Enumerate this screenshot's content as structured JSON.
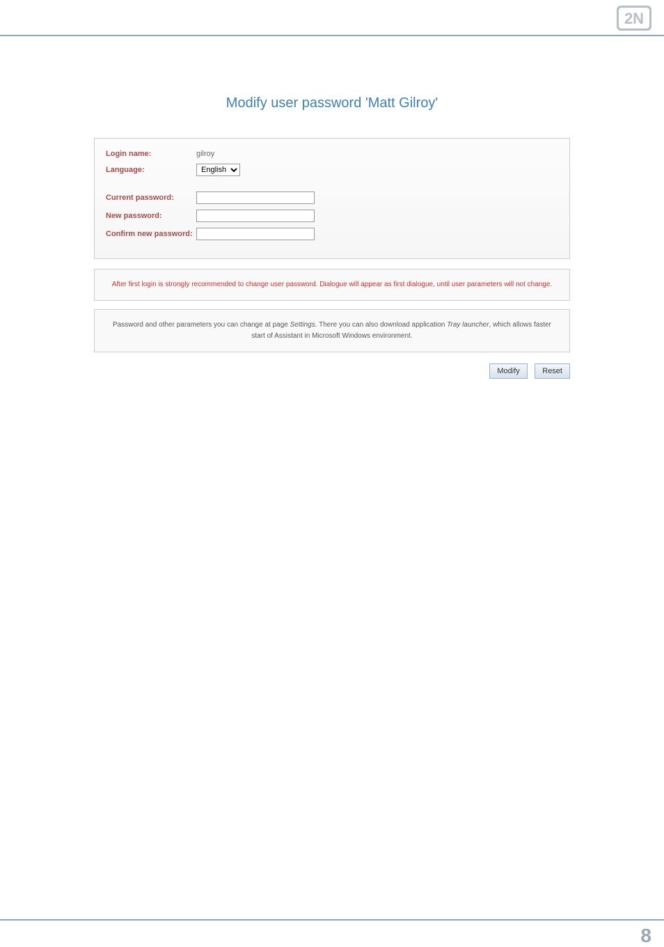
{
  "header": {
    "logo": "2N"
  },
  "title": "Modify user password 'Matt Gilroy'",
  "form": {
    "login_name_label": "Login name:",
    "login_name_value": "gilroy",
    "language_label": "Language:",
    "language_value": "English",
    "current_password_label": "Current password:",
    "new_password_label": "New password:",
    "confirm_password_label": "Confirm new password:"
  },
  "warning": "After first login is strongly recommended to change user password. Dialogue will appear as first dialogue, until user parameters will not change.",
  "hint": {
    "prefix": "Password and other parameters you can change at page ",
    "settings_em": "Settings",
    "mid": ". There you can also download application ",
    "tray_em": "Tray launcher",
    "suffix": ", which allows faster start of Assistant in Microsoft Windows environment."
  },
  "buttons": {
    "modify": "Modify",
    "reset": "Reset"
  },
  "page_number": "8"
}
